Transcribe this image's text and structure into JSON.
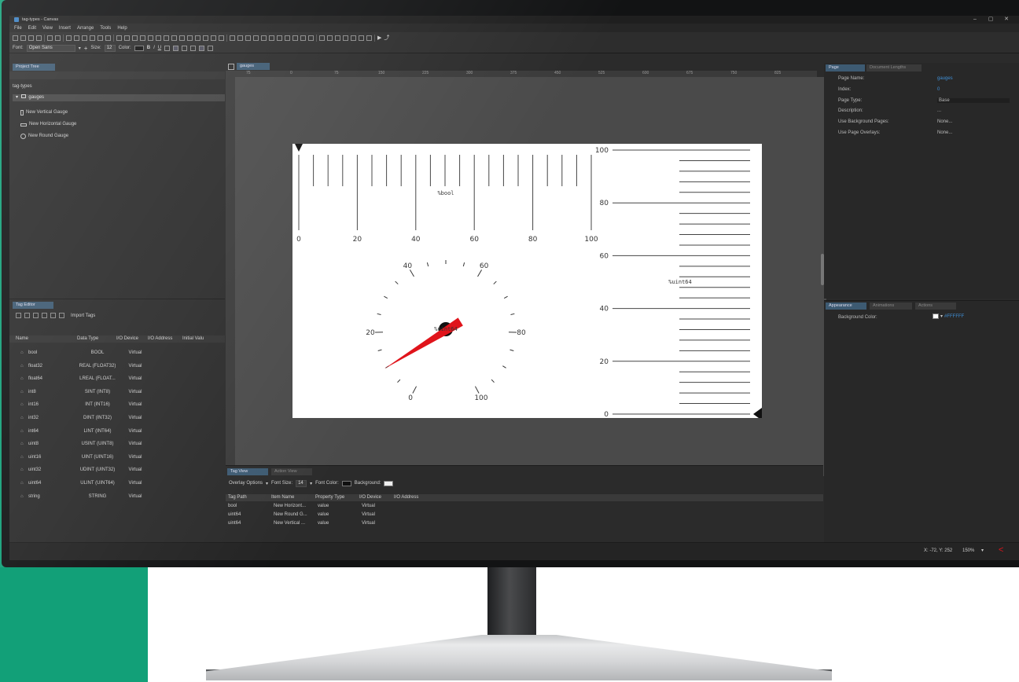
{
  "window": {
    "title": "tag-types - Canvas",
    "controls": [
      "–",
      "▢",
      "✕"
    ]
  },
  "menu": [
    "File",
    "Edit",
    "View",
    "Insert",
    "Arrange",
    "Tools",
    "Help"
  ],
  "format_bar": {
    "font_label": "Font:",
    "font_value": "Open Sans",
    "size_label": "Size:",
    "size_value": "12",
    "color_label": "Color:",
    "bold": "B",
    "italic": "I",
    "underline": "U"
  },
  "project_tree": {
    "tab": "Project Tree",
    "root": "tag-types",
    "folder": "gauges",
    "items": [
      "New Vertical Gauge",
      "New Horizontal Gauge",
      "New Round Gauge"
    ]
  },
  "tag_editor": {
    "tab": "Tag Editor",
    "import_label": "Import Tags",
    "columns": [
      "Name",
      "Data Type",
      "I/O Device",
      "I/O Address",
      "Initial Valu"
    ],
    "rows": [
      {
        "name": "bool",
        "type": "BOOL",
        "device": "Virtual"
      },
      {
        "name": "float32",
        "type": "REAL (FLOAT32)",
        "device": "Virtual"
      },
      {
        "name": "float64",
        "type": "LREAL (FLOAT...",
        "device": "Virtual"
      },
      {
        "name": "int8",
        "type": "SINT (INT8)",
        "device": "Virtual"
      },
      {
        "name": "int16",
        "type": "INT (INT16)",
        "device": "Virtual"
      },
      {
        "name": "int32",
        "type": "DINT (INT32)",
        "device": "Virtual"
      },
      {
        "name": "int64",
        "type": "LINT (INT64)",
        "device": "Virtual"
      },
      {
        "name": "uint8",
        "type": "USINT (UINT8)",
        "device": "Virtual"
      },
      {
        "name": "uint16",
        "type": "UINT (UINT16)",
        "device": "Virtual"
      },
      {
        "name": "uint32",
        "type": "UDINT (UINT32)",
        "device": "Virtual"
      },
      {
        "name": "uint64",
        "type": "ULINT (UINT64)",
        "device": "Virtual"
      },
      {
        "name": "string",
        "type": "STRING",
        "device": "Virtual"
      }
    ]
  },
  "canvas": {
    "tab": "gauges",
    "ruler_ticks": [
      "75",
      "0",
      "75",
      "150",
      "225",
      "300",
      "375",
      "450",
      "525",
      "600",
      "675",
      "750",
      "825"
    ],
    "h_gauge": {
      "labels": [
        "0",
        "20",
        "40",
        "60",
        "80",
        "100"
      ],
      "tag": "%bool"
    },
    "round_gauge": {
      "labels": [
        "0",
        "20",
        "40",
        "60",
        "80",
        "100"
      ],
      "tag": "%uint64",
      "value_fraction": 0.1
    },
    "v_gauge": {
      "labels": [
        "100",
        "80",
        "60",
        "40",
        "20",
        "0"
      ],
      "tag": "%uint64"
    }
  },
  "tag_view": {
    "tabs": [
      "Tag View",
      "Action View"
    ],
    "overlay_label": "Overlay Options",
    "font_size_label": "Font Size:",
    "font_size_value": "14",
    "font_color_label": "Font Color:",
    "background_label": "Background:",
    "columns": [
      "Tag Path",
      "Item Name",
      "Property Type",
      "I/O Device",
      "I/O Address"
    ],
    "rows": [
      [
        "bool",
        "New Horizont...",
        "value",
        "Virtual",
        ""
      ],
      [
        "uint64",
        "New Round G...",
        "value",
        "Virtual",
        ""
      ],
      [
        "uint64",
        "New Vertical ...",
        "value",
        "Virtual",
        ""
      ]
    ]
  },
  "page_props": {
    "tabs": [
      "Page",
      "Document Lengths"
    ],
    "rows": [
      {
        "key": "Page Name:",
        "value": "gauges"
      },
      {
        "key": "Index:",
        "value": "0"
      },
      {
        "key": "Page Type:",
        "value": "Base"
      },
      {
        "key": "Description:",
        "value": "..."
      },
      {
        "key": "Use Background Pages:",
        "value": "None..."
      },
      {
        "key": "Use Page Overlays:",
        "value": "None..."
      }
    ]
  },
  "appearance": {
    "tabs": [
      "Appearance",
      "Animations",
      "Actions"
    ],
    "key": "Background Color:",
    "value": "#FFFFFF"
  },
  "status": {
    "coords": "X: -72, Y: 252",
    "zoom": "150%"
  },
  "colors": {
    "accent": "#3d5a72",
    "needle": "#e0141b",
    "brand_green": "#12a078"
  }
}
